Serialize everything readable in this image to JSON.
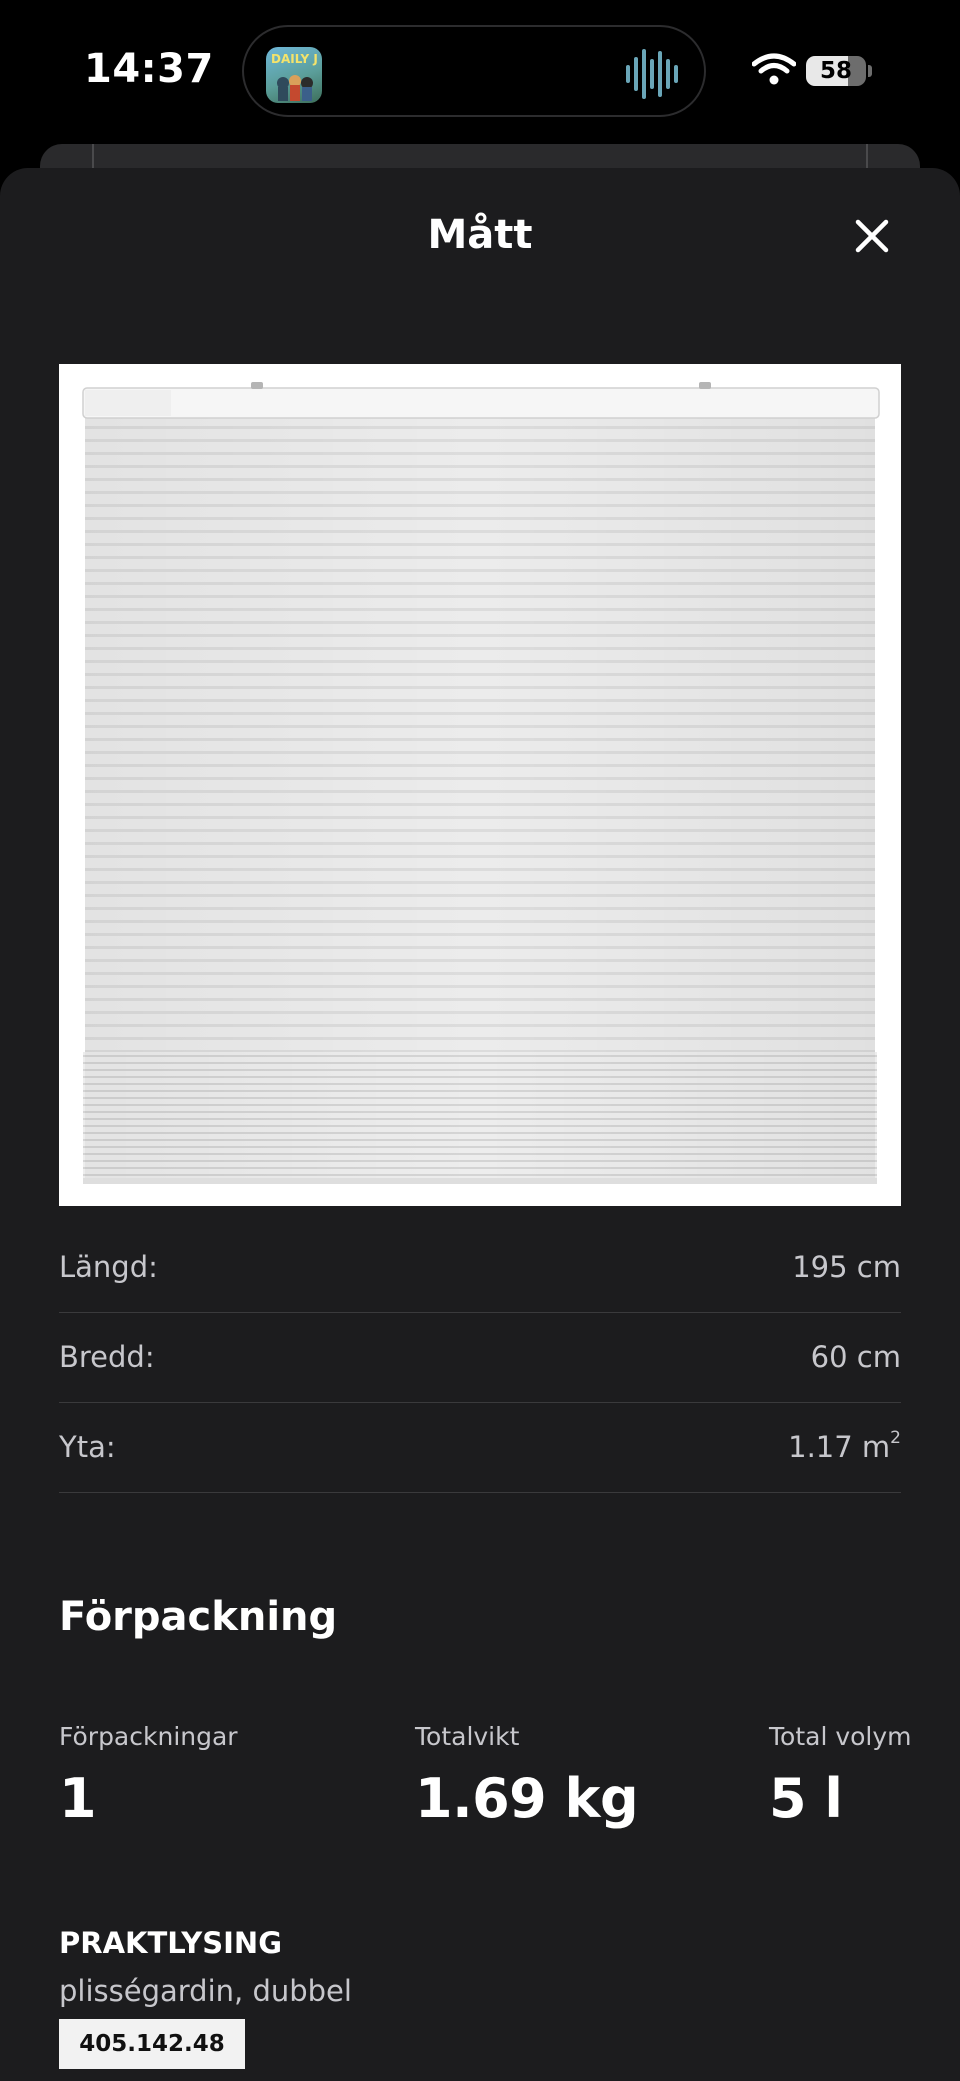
{
  "status_bar": {
    "time": "14:37",
    "live_activity_app_label": "DAILY J",
    "battery_level": "58",
    "icons": [
      "wifi-icon",
      "battery-icon",
      "audio-waveform-icon"
    ]
  },
  "sheet": {
    "title": "Mått",
    "close_icon": "close-icon"
  },
  "dimensions": [
    {
      "label": "Längd:",
      "value": "195 cm"
    },
    {
      "label": "Bredd:",
      "value": "60 cm"
    },
    {
      "label": "Yta:",
      "value": "1.17 m",
      "superscript": "2"
    }
  ],
  "packaging": {
    "title": "Förpackning",
    "stats": [
      {
        "label": "Förpackningar",
        "value": "1"
      },
      {
        "label": "Totalvikt",
        "value": "1.69 kg"
      },
      {
        "label": "Total volym",
        "value": "5 l"
      }
    ]
  },
  "product": {
    "name": "PRAKTLYSING",
    "description": "plisségardin, dubbel",
    "article_number": "405.142.48"
  },
  "colors": {
    "background": "#000000",
    "sheet": "#1c1c1e",
    "divider": "#3a3a3c",
    "secondary_text": "#c7c7cc",
    "article_badge": "#f2f2f2"
  }
}
